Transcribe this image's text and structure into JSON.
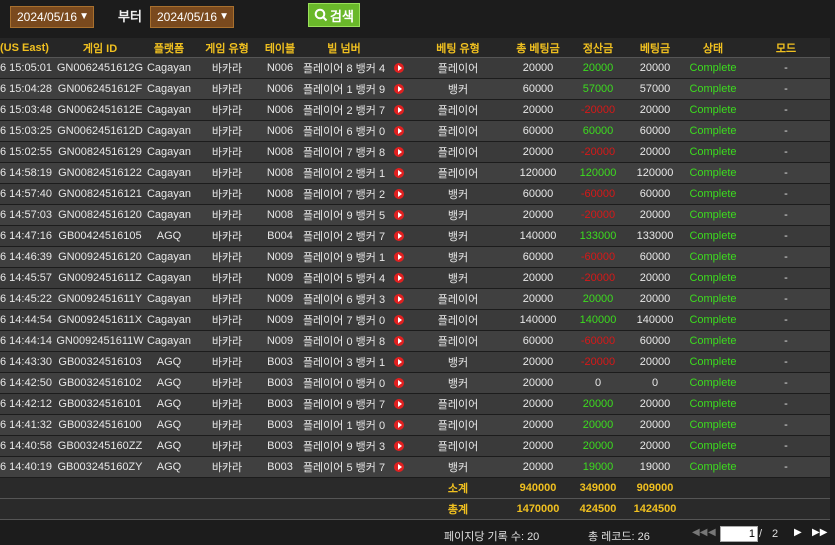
{
  "filters": {
    "start_date": "2024/05/16",
    "end_date": "2024/05/16",
    "from_label": "부터",
    "search_label": "검색"
  },
  "table": {
    "columns": [
      "(US East)",
      "게임 ID",
      "플랫폼",
      "게임 유형",
      "테이블",
      "빌 넘버",
      "",
      "베팅 유형",
      "총 베팅금",
      "정산금",
      "베팅금",
      "상태",
      "모드"
    ],
    "rows": [
      {
        "time": "6 15:05:01",
        "game_id": "GN0062451612G",
        "platform": "Cagayan",
        "game_type": "바카라",
        "table": "N006",
        "bill": "플레이어 8 뱅커 4",
        "bet_type": "플레이어",
        "total": "20000",
        "settle": "20000",
        "settle_sign": "pos",
        "bet": "20000",
        "status": "Complete",
        "mode": "-"
      },
      {
        "time": "6 15:04:28",
        "game_id": "GN0062451612F",
        "platform": "Cagayan",
        "game_type": "바카라",
        "table": "N006",
        "bill": "플레이어 1 뱅커 9",
        "bet_type": "뱅커",
        "total": "60000",
        "settle": "57000",
        "settle_sign": "pos",
        "bet": "57000",
        "status": "Complete",
        "mode": "-"
      },
      {
        "time": "6 15:03:48",
        "game_id": "GN0062451612E",
        "platform": "Cagayan",
        "game_type": "바카라",
        "table": "N006",
        "bill": "플레이어 2 뱅커 7",
        "bet_type": "플레이어",
        "total": "20000",
        "settle": "-20000",
        "settle_sign": "neg",
        "bet": "20000",
        "status": "Complete",
        "mode": "-"
      },
      {
        "time": "6 15:03:25",
        "game_id": "GN0062451612D",
        "platform": "Cagayan",
        "game_type": "바카라",
        "table": "N006",
        "bill": "플레이어 6 뱅커 0",
        "bet_type": "플레이어",
        "total": "60000",
        "settle": "60000",
        "settle_sign": "pos",
        "bet": "60000",
        "status": "Complete",
        "mode": "-"
      },
      {
        "time": "6 15:02:55",
        "game_id": "GN00824516129",
        "platform": "Cagayan",
        "game_type": "바카라",
        "table": "N008",
        "bill": "플레이어 7 뱅커 8",
        "bet_type": "플레이어",
        "total": "20000",
        "settle": "-20000",
        "settle_sign": "neg",
        "bet": "20000",
        "status": "Complete",
        "mode": "-"
      },
      {
        "time": "6 14:58:19",
        "game_id": "GN00824516122",
        "platform": "Cagayan",
        "game_type": "바카라",
        "table": "N008",
        "bill": "플레이어 2 뱅커 1",
        "bet_type": "플레이어",
        "total": "120000",
        "settle": "120000",
        "settle_sign": "pos",
        "bet": "120000",
        "status": "Complete",
        "mode": "-"
      },
      {
        "time": "6 14:57:40",
        "game_id": "GN00824516121",
        "platform": "Cagayan",
        "game_type": "바카라",
        "table": "N008",
        "bill": "플레이어 7 뱅커 2",
        "bet_type": "뱅커",
        "total": "60000",
        "settle": "-60000",
        "settle_sign": "neg",
        "bet": "60000",
        "status": "Complete",
        "mode": "-"
      },
      {
        "time": "6 14:57:03",
        "game_id": "GN00824516120",
        "platform": "Cagayan",
        "game_type": "바카라",
        "table": "N008",
        "bill": "플레이어 9 뱅커 5",
        "bet_type": "뱅커",
        "total": "20000",
        "settle": "-20000",
        "settle_sign": "neg",
        "bet": "20000",
        "status": "Complete",
        "mode": "-"
      },
      {
        "time": "6 14:47:16",
        "game_id": "GB00424516105",
        "platform": "AGQ",
        "game_type": "바카라",
        "table": "B004",
        "bill": "플레이어 2 뱅커 7",
        "bet_type": "뱅커",
        "total": "140000",
        "settle": "133000",
        "settle_sign": "pos",
        "bet": "133000",
        "status": "Complete",
        "mode": "-"
      },
      {
        "time": "6 14:46:39",
        "game_id": "GN00924516120",
        "platform": "Cagayan",
        "game_type": "바카라",
        "table": "N009",
        "bill": "플레이어 9 뱅커 1",
        "bet_type": "뱅커",
        "total": "60000",
        "settle": "-60000",
        "settle_sign": "neg",
        "bet": "60000",
        "status": "Complete",
        "mode": "-"
      },
      {
        "time": "6 14:45:57",
        "game_id": "GN0092451611Z",
        "platform": "Cagayan",
        "game_type": "바카라",
        "table": "N009",
        "bill": "플레이어 5 뱅커 4",
        "bet_type": "뱅커",
        "total": "20000",
        "settle": "-20000",
        "settle_sign": "neg",
        "bet": "20000",
        "status": "Complete",
        "mode": "-"
      },
      {
        "time": "6 14:45:22",
        "game_id": "GN0092451611Y",
        "platform": "Cagayan",
        "game_type": "바카라",
        "table": "N009",
        "bill": "플레이어 6 뱅커 3",
        "bet_type": "플레이어",
        "total": "20000",
        "settle": "20000",
        "settle_sign": "pos",
        "bet": "20000",
        "status": "Complete",
        "mode": "-"
      },
      {
        "time": "6 14:44:54",
        "game_id": "GN0092451611X",
        "platform": "Cagayan",
        "game_type": "바카라",
        "table": "N009",
        "bill": "플레이어 7 뱅커 0",
        "bet_type": "플레이어",
        "total": "140000",
        "settle": "140000",
        "settle_sign": "pos",
        "bet": "140000",
        "status": "Complete",
        "mode": "-"
      },
      {
        "time": "6 14:44:14",
        "game_id": "GN0092451611W",
        "platform": "Cagayan",
        "game_type": "바카라",
        "table": "N009",
        "bill": "플레이어 0 뱅커 8",
        "bet_type": "플레이어",
        "total": "60000",
        "settle": "-60000",
        "settle_sign": "neg",
        "bet": "60000",
        "status": "Complete",
        "mode": "-"
      },
      {
        "time": "6 14:43:30",
        "game_id": "GB00324516103",
        "platform": "AGQ",
        "game_type": "바카라",
        "table": "B003",
        "bill": "플레이어 3 뱅커 1",
        "bet_type": "뱅커",
        "total": "20000",
        "settle": "-20000",
        "settle_sign": "neg",
        "bet": "20000",
        "status": "Complete",
        "mode": "-"
      },
      {
        "time": "6 14:42:50",
        "game_id": "GB00324516102",
        "platform": "AGQ",
        "game_type": "바카라",
        "table": "B003",
        "bill": "플레이어 0 뱅커 0",
        "bet_type": "뱅커",
        "total": "20000",
        "settle": "0",
        "settle_sign": "zero",
        "bet": "0",
        "status": "Complete",
        "mode": "-"
      },
      {
        "time": "6 14:42:12",
        "game_id": "GB00324516101",
        "platform": "AGQ",
        "game_type": "바카라",
        "table": "B003",
        "bill": "플레이어 9 뱅커 7",
        "bet_type": "플레이어",
        "total": "20000",
        "settle": "20000",
        "settle_sign": "pos",
        "bet": "20000",
        "status": "Complete",
        "mode": "-"
      },
      {
        "time": "6 14:41:32",
        "game_id": "GB00324516100",
        "platform": "AGQ",
        "game_type": "바카라",
        "table": "B003",
        "bill": "플레이어 1 뱅커 0",
        "bet_type": "플레이어",
        "total": "20000",
        "settle": "20000",
        "settle_sign": "pos",
        "bet": "20000",
        "status": "Complete",
        "mode": "-"
      },
      {
        "time": "6 14:40:58",
        "game_id": "GB003245160ZZ",
        "platform": "AGQ",
        "game_type": "바카라",
        "table": "B003",
        "bill": "플레이어 9 뱅커 3",
        "bet_type": "플레이어",
        "total": "20000",
        "settle": "20000",
        "settle_sign": "pos",
        "bet": "20000",
        "status": "Complete",
        "mode": "-"
      },
      {
        "time": "6 14:40:19",
        "game_id": "GB003245160ZY",
        "platform": "AGQ",
        "game_type": "바카라",
        "table": "B003",
        "bill": "플레이어 5 뱅커 7",
        "bet_type": "뱅커",
        "total": "20000",
        "settle": "19000",
        "settle_sign": "pos",
        "bet": "19000",
        "status": "Complete",
        "mode": "-"
      }
    ],
    "subtotal": {
      "label": "소계",
      "total": "940000",
      "settle": "349000",
      "bet": "909000"
    },
    "grand_total": {
      "label": "총계",
      "total": "1470000",
      "settle": "424500",
      "bet": "1424500"
    }
  },
  "pagination": {
    "per_page_label": "페이지당 기록 수: 20",
    "total_label": "총 레코드: 26",
    "current_page": "1",
    "separator": "/",
    "total_pages": "2"
  },
  "colors": {
    "positive": "#3cdc1e",
    "negative": "#d81818",
    "header": "#f0c020",
    "accent_button": "#6ab82a",
    "date_box": "#7a4a1e"
  }
}
